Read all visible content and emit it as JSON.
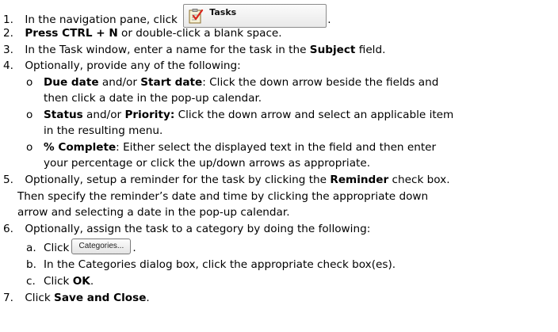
{
  "steps": {
    "s1": {
      "num": "1.",
      "pre": "In the navigation pane, click",
      "button_label": "Tasks",
      "post": "."
    },
    "s2": {
      "num": "2.",
      "bold": "Press CTRL + N",
      "text": " or double-click a blank space."
    },
    "s3": {
      "num": "3.",
      "pre": "In the Task window, enter a name for the task in the ",
      "bold": "Subject",
      "post": " field."
    },
    "s4": {
      "num": "4.",
      "text": "Optionally, provide any of the following:",
      "b1": {
        "bullet": "o",
        "bold1": "Due date",
        "mid": " and/or ",
        "bold2": "Start date",
        "post": ": Click the down arrow beside the fields and",
        "cont": "then click a date in the pop-up calendar."
      },
      "b2": {
        "bullet": "o",
        "bold1": "Status",
        "mid": " and/or ",
        "bold2": "Priority:",
        "post": " Click the down arrow and select an applicable item",
        "cont": "in the resulting menu."
      },
      "b3": {
        "bullet": "o",
        "bold": "% Complete",
        "post": ": Either select the displayed text in the field and then enter",
        "cont": "your percentage or click the up/down arrows as appropriate."
      }
    },
    "s5": {
      "num": "5.",
      "pre": "Optionally, setup a reminder for the task by clicking the ",
      "bold": "Reminder",
      "post": " check box.",
      "cont1": "Then specify the reminder’s date and time by clicking the appropriate down",
      "cont2": "arrow and selecting a date in the pop-up calendar."
    },
    "s6": {
      "num": "6.",
      "text": "Optionally, assign the task to a category by doing the following:",
      "a": {
        "letter": "a.",
        "pre": "Click",
        "button_label": "Categories...",
        "post": "."
      },
      "b": {
        "letter": "b.",
        "text": "In the Categories dialog box, click the appropriate check box(es)."
      },
      "c": {
        "letter": "c.",
        "pre": "Click ",
        "bold": "OK",
        "post": "."
      }
    },
    "s7": {
      "num": "7.",
      "pre": "Click ",
      "bold": "Save and Close",
      "post": "."
    }
  }
}
